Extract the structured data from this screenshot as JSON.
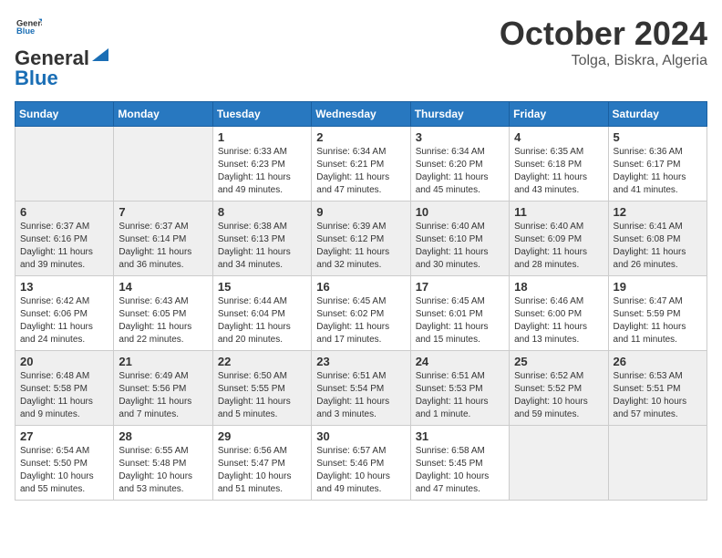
{
  "header": {
    "logo_line1": "General",
    "logo_line2": "Blue",
    "month_year": "October 2024",
    "location": "Tolga, Biskra, Algeria"
  },
  "weekdays": [
    "Sunday",
    "Monday",
    "Tuesday",
    "Wednesday",
    "Thursday",
    "Friday",
    "Saturday"
  ],
  "weeks": [
    [
      {
        "day": "",
        "detail": ""
      },
      {
        "day": "",
        "detail": ""
      },
      {
        "day": "1",
        "detail": "Sunrise: 6:33 AM\nSunset: 6:23 PM\nDaylight: 11 hours and 49 minutes."
      },
      {
        "day": "2",
        "detail": "Sunrise: 6:34 AM\nSunset: 6:21 PM\nDaylight: 11 hours and 47 minutes."
      },
      {
        "day": "3",
        "detail": "Sunrise: 6:34 AM\nSunset: 6:20 PM\nDaylight: 11 hours and 45 minutes."
      },
      {
        "day": "4",
        "detail": "Sunrise: 6:35 AM\nSunset: 6:18 PM\nDaylight: 11 hours and 43 minutes."
      },
      {
        "day": "5",
        "detail": "Sunrise: 6:36 AM\nSunset: 6:17 PM\nDaylight: 11 hours and 41 minutes."
      }
    ],
    [
      {
        "day": "6",
        "detail": "Sunrise: 6:37 AM\nSunset: 6:16 PM\nDaylight: 11 hours and 39 minutes."
      },
      {
        "day": "7",
        "detail": "Sunrise: 6:37 AM\nSunset: 6:14 PM\nDaylight: 11 hours and 36 minutes."
      },
      {
        "day": "8",
        "detail": "Sunrise: 6:38 AM\nSunset: 6:13 PM\nDaylight: 11 hours and 34 minutes."
      },
      {
        "day": "9",
        "detail": "Sunrise: 6:39 AM\nSunset: 6:12 PM\nDaylight: 11 hours and 32 minutes."
      },
      {
        "day": "10",
        "detail": "Sunrise: 6:40 AM\nSunset: 6:10 PM\nDaylight: 11 hours and 30 minutes."
      },
      {
        "day": "11",
        "detail": "Sunrise: 6:40 AM\nSunset: 6:09 PM\nDaylight: 11 hours and 28 minutes."
      },
      {
        "day": "12",
        "detail": "Sunrise: 6:41 AM\nSunset: 6:08 PM\nDaylight: 11 hours and 26 minutes."
      }
    ],
    [
      {
        "day": "13",
        "detail": "Sunrise: 6:42 AM\nSunset: 6:06 PM\nDaylight: 11 hours and 24 minutes."
      },
      {
        "day": "14",
        "detail": "Sunrise: 6:43 AM\nSunset: 6:05 PM\nDaylight: 11 hours and 22 minutes."
      },
      {
        "day": "15",
        "detail": "Sunrise: 6:44 AM\nSunset: 6:04 PM\nDaylight: 11 hours and 20 minutes."
      },
      {
        "day": "16",
        "detail": "Sunrise: 6:45 AM\nSunset: 6:02 PM\nDaylight: 11 hours and 17 minutes."
      },
      {
        "day": "17",
        "detail": "Sunrise: 6:45 AM\nSunset: 6:01 PM\nDaylight: 11 hours and 15 minutes."
      },
      {
        "day": "18",
        "detail": "Sunrise: 6:46 AM\nSunset: 6:00 PM\nDaylight: 11 hours and 13 minutes."
      },
      {
        "day": "19",
        "detail": "Sunrise: 6:47 AM\nSunset: 5:59 PM\nDaylight: 11 hours and 11 minutes."
      }
    ],
    [
      {
        "day": "20",
        "detail": "Sunrise: 6:48 AM\nSunset: 5:58 PM\nDaylight: 11 hours and 9 minutes."
      },
      {
        "day": "21",
        "detail": "Sunrise: 6:49 AM\nSunset: 5:56 PM\nDaylight: 11 hours and 7 minutes."
      },
      {
        "day": "22",
        "detail": "Sunrise: 6:50 AM\nSunset: 5:55 PM\nDaylight: 11 hours and 5 minutes."
      },
      {
        "day": "23",
        "detail": "Sunrise: 6:51 AM\nSunset: 5:54 PM\nDaylight: 11 hours and 3 minutes."
      },
      {
        "day": "24",
        "detail": "Sunrise: 6:51 AM\nSunset: 5:53 PM\nDaylight: 11 hours and 1 minute."
      },
      {
        "day": "25",
        "detail": "Sunrise: 6:52 AM\nSunset: 5:52 PM\nDaylight: 10 hours and 59 minutes."
      },
      {
        "day": "26",
        "detail": "Sunrise: 6:53 AM\nSunset: 5:51 PM\nDaylight: 10 hours and 57 minutes."
      }
    ],
    [
      {
        "day": "27",
        "detail": "Sunrise: 6:54 AM\nSunset: 5:50 PM\nDaylight: 10 hours and 55 minutes."
      },
      {
        "day": "28",
        "detail": "Sunrise: 6:55 AM\nSunset: 5:48 PM\nDaylight: 10 hours and 53 minutes."
      },
      {
        "day": "29",
        "detail": "Sunrise: 6:56 AM\nSunset: 5:47 PM\nDaylight: 10 hours and 51 minutes."
      },
      {
        "day": "30",
        "detail": "Sunrise: 6:57 AM\nSunset: 5:46 PM\nDaylight: 10 hours and 49 minutes."
      },
      {
        "day": "31",
        "detail": "Sunrise: 6:58 AM\nSunset: 5:45 PM\nDaylight: 10 hours and 47 minutes."
      },
      {
        "day": "",
        "detail": ""
      },
      {
        "day": "",
        "detail": ""
      }
    ]
  ]
}
